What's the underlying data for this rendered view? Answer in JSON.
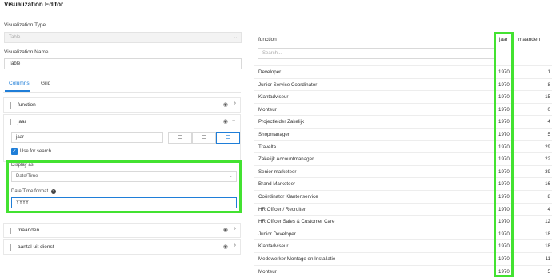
{
  "title": "Visualization Editor",
  "vis_type": {
    "label": "Visualization Type",
    "value": "Table"
  },
  "vis_name": {
    "label": "Visualization Name",
    "value": "Table"
  },
  "tabs": [
    "Columns",
    "Grid"
  ],
  "columns": [
    {
      "label": "function"
    },
    {
      "label": "jaar"
    },
    {
      "label": "maanden"
    },
    {
      "label": "aantal uit dienst"
    }
  ],
  "jaar_title": "jaar",
  "use_for_search": "Use for search",
  "display_as": {
    "label": "Display as:",
    "value": "Date/Time"
  },
  "dt_format": {
    "label": "Date/Time format",
    "value": "YYYY"
  },
  "table": {
    "headers": [
      "function",
      "jaar",
      "maanden"
    ],
    "search_placeholder": "Search...",
    "rows": [
      [
        "Developer",
        "1970",
        "1"
      ],
      [
        "Junior Service Coordinator",
        "1970",
        "8"
      ],
      [
        "Klantadviseur",
        "1970",
        "15"
      ],
      [
        "Monteur",
        "1970",
        "0"
      ],
      [
        "Projectleider Zakelijk",
        "1970",
        "4"
      ],
      [
        "Shopmanager",
        "1970",
        "5"
      ],
      [
        "Travelta",
        "1970",
        "29"
      ],
      [
        "Zakelijk Accountmanager",
        "1970",
        "22"
      ],
      [
        "Senior marketeer",
        "1970",
        "39"
      ],
      [
        "Brand Marketeer",
        "1970",
        "16"
      ],
      [
        "Coördinator Klantenservice",
        "1970",
        "8"
      ],
      [
        "HR Officer / Recruiter",
        "1970",
        "4"
      ],
      [
        "HR Officer Sales & Customer Care",
        "1970",
        "12"
      ],
      [
        "Junior Developer",
        "1970",
        "18"
      ],
      [
        "Klantadviseur",
        "1970",
        "18"
      ],
      [
        "Medewerker Montage en Installatie",
        "1970",
        "11"
      ],
      [
        "Monteur",
        "1970",
        "5"
      ]
    ]
  },
  "accent": "#1f7ed8",
  "highlight": "#43e231"
}
